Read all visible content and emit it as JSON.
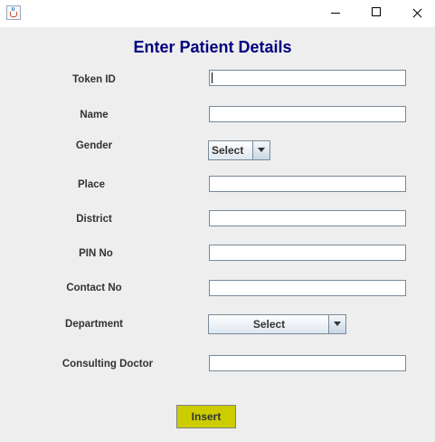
{
  "window": {
    "title": ""
  },
  "form": {
    "heading": "Enter Patient Details",
    "labels": {
      "token_id": "Token  ID",
      "name": "Name",
      "gender": "Gender",
      "place": "Place",
      "district": "District",
      "pin_no": "PIN No",
      "contact_no": "Contact No",
      "department": "Department",
      "consulting_doctor": "Consulting Doctor"
    },
    "values": {
      "token_id": "",
      "name": "",
      "place": "",
      "district": "",
      "pin_no": "",
      "contact_no": "",
      "consulting_doctor": ""
    },
    "gender_selected": "Select",
    "department_selected": "Select",
    "insert_label": "Insert"
  },
  "colors": {
    "heading": "#000080",
    "insert_button": "#cccc00",
    "background": "#eeeeee"
  }
}
